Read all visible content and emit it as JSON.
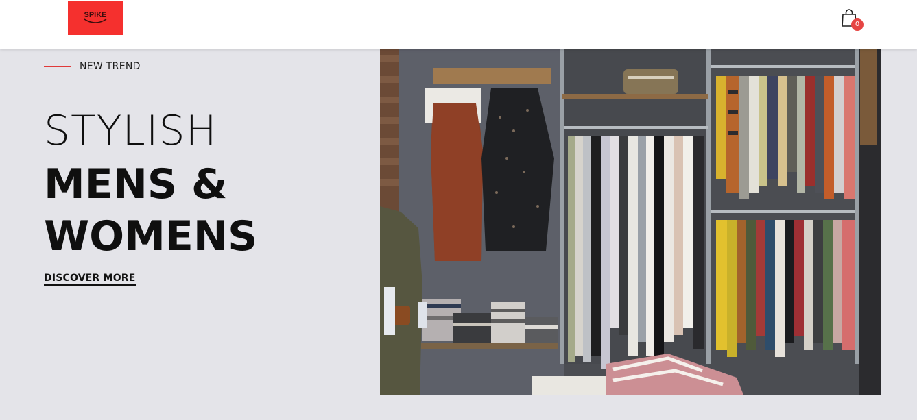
{
  "header": {
    "logo_text": "SPIKE",
    "cart_count": "0",
    "cart_icon": "shopping-bag-icon"
  },
  "colors": {
    "accent": "#e03a3a",
    "logo_bg": "#f5302e",
    "badge": "#e64543",
    "page_bg": "#e4e4e9"
  },
  "hero": {
    "eyebrow": "NEW TREND",
    "title_line1": "STYLISH",
    "title_line2": "MENS &",
    "title_line3": "WOMENS",
    "cta": "DISCOVER MORE",
    "image_subject": "clothing store racks with dresses, shirts and folded sweaters"
  }
}
